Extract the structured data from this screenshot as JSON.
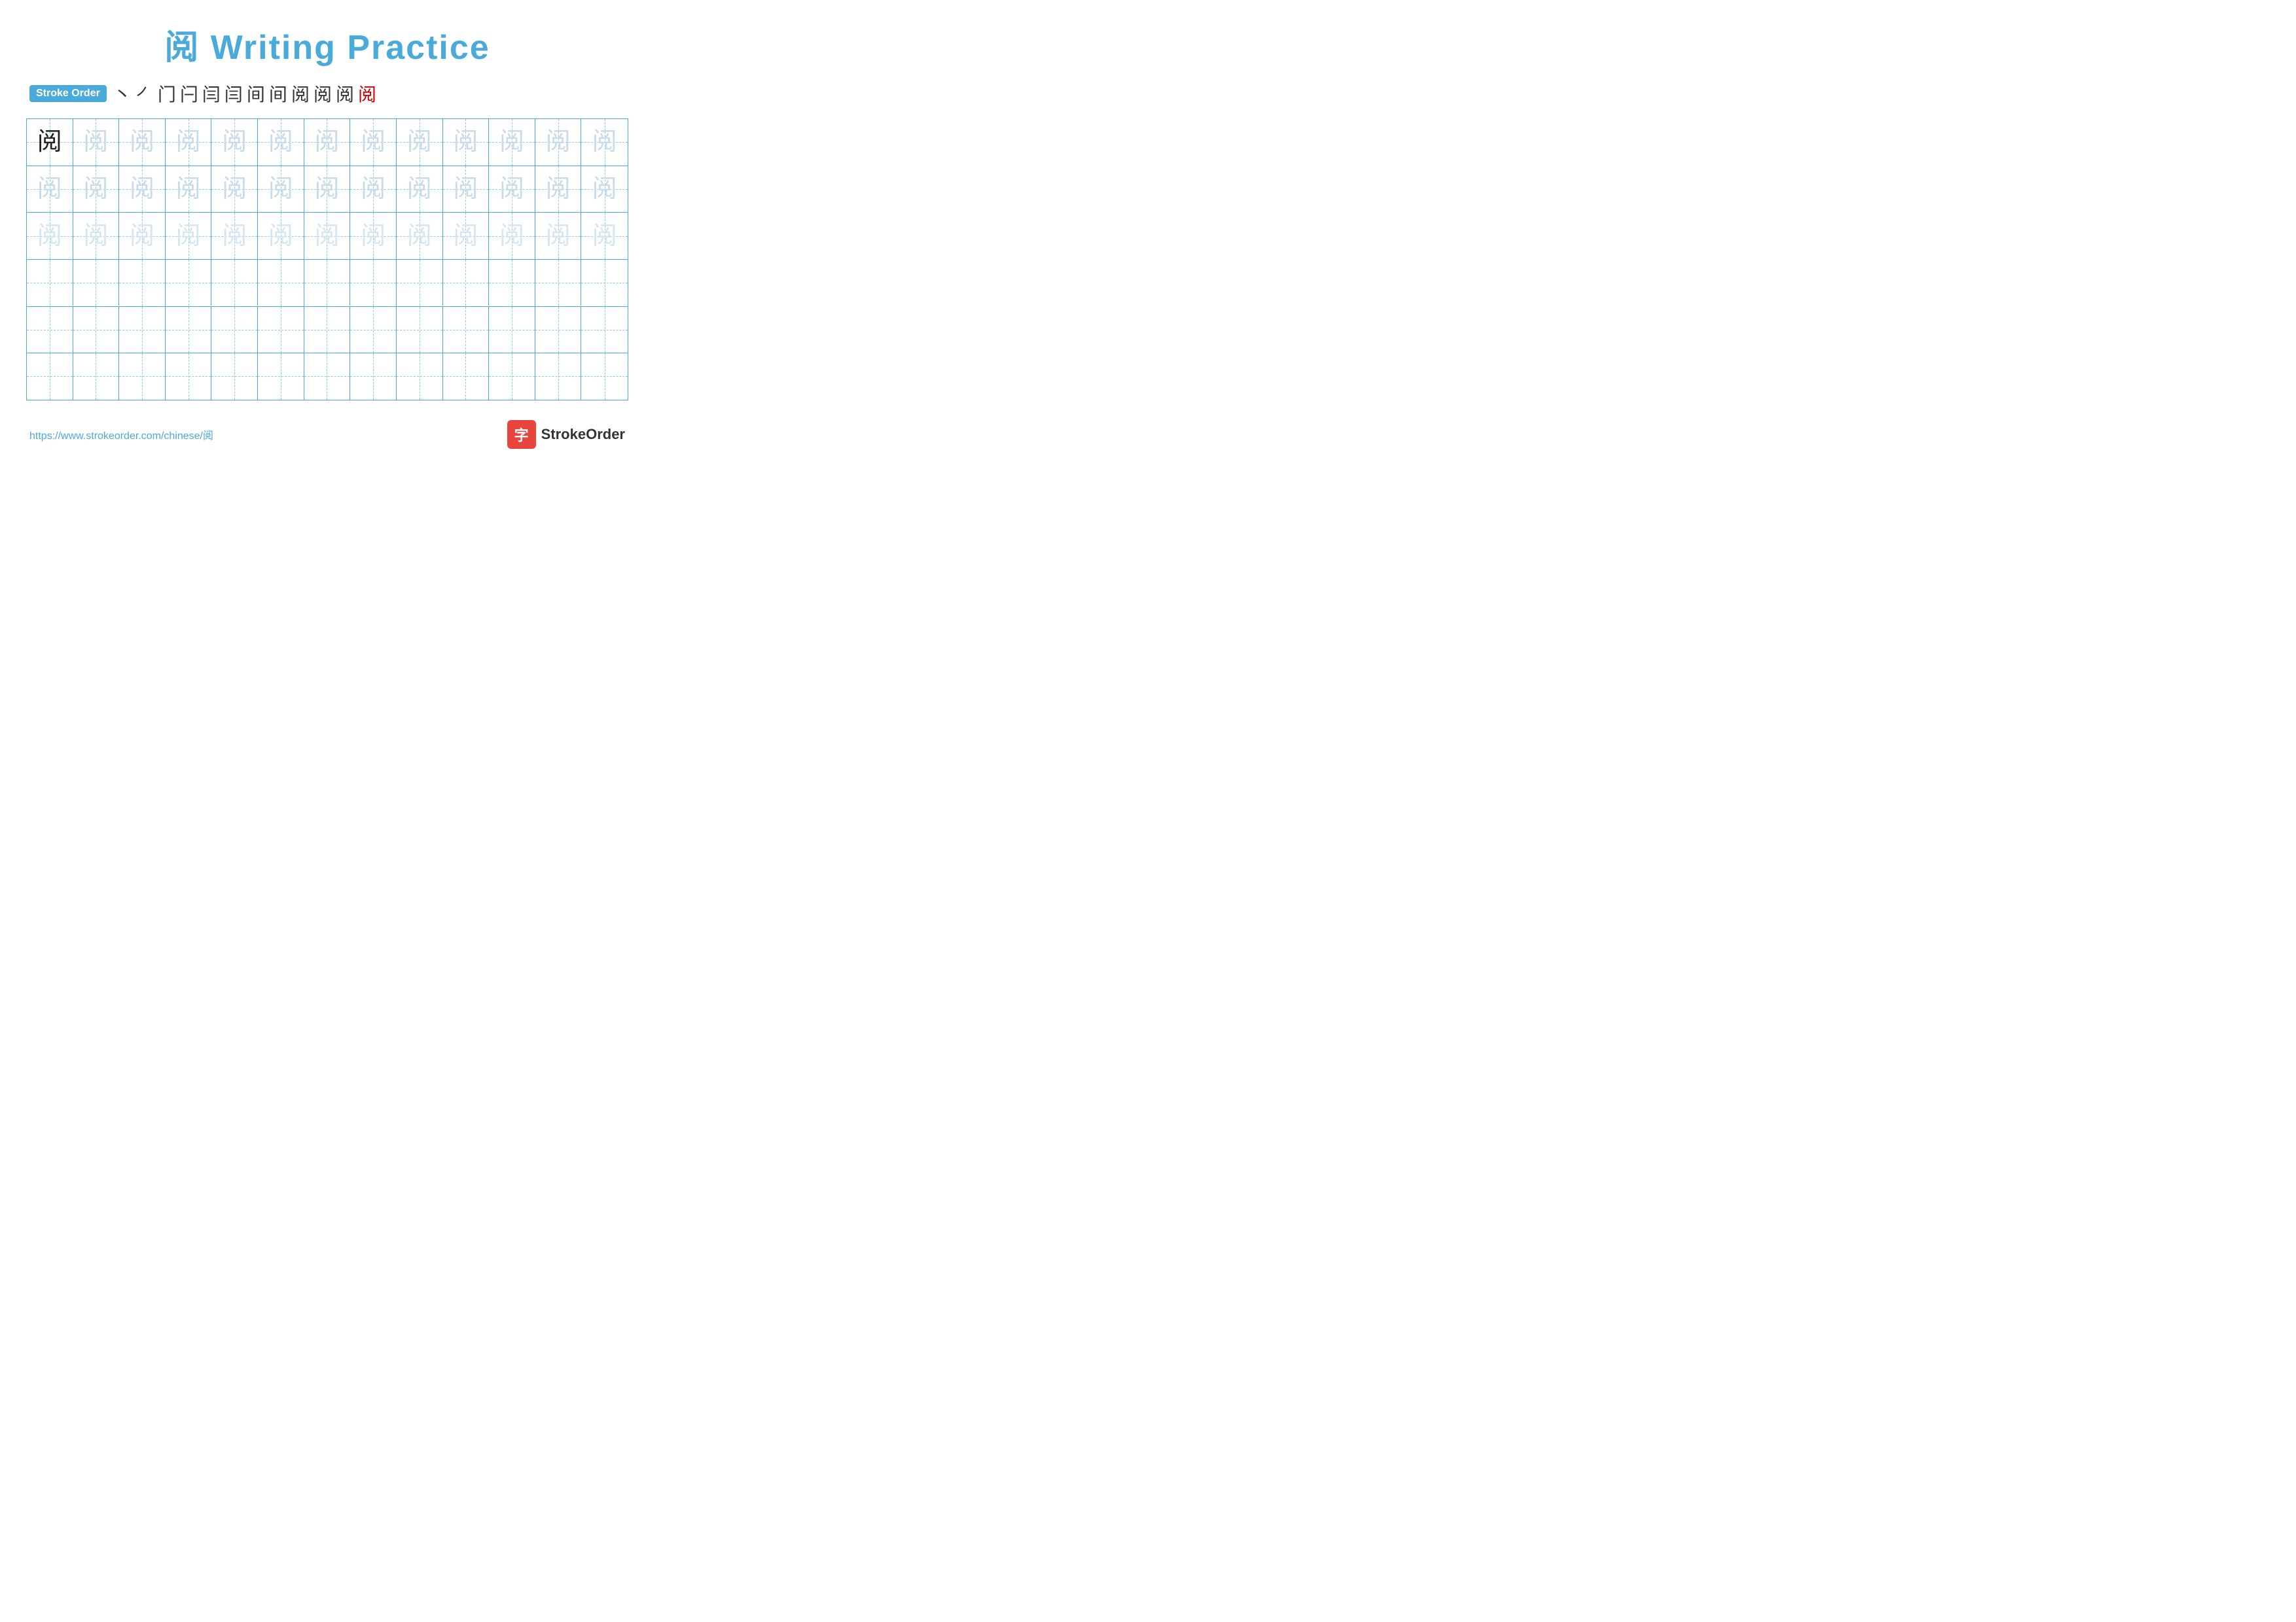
{
  "title": "阅 Writing Practice",
  "stroke_order": {
    "badge_label": "Stroke Order",
    "strokes": [
      "丶",
      "㇒",
      "门",
      "闩",
      "闫",
      "闫",
      "闫",
      "间",
      "阅",
      "阅",
      "阅",
      "阅"
    ]
  },
  "character": "阅",
  "grid": {
    "rows": 6,
    "cols": 13,
    "row_types": [
      "dark_then_light1",
      "light1",
      "light2",
      "empty",
      "empty",
      "empty"
    ]
  },
  "footer": {
    "url": "https://www.strokeorder.com/chinese/阅",
    "logo_text": "StrokeOrder",
    "logo_icon": "字"
  }
}
